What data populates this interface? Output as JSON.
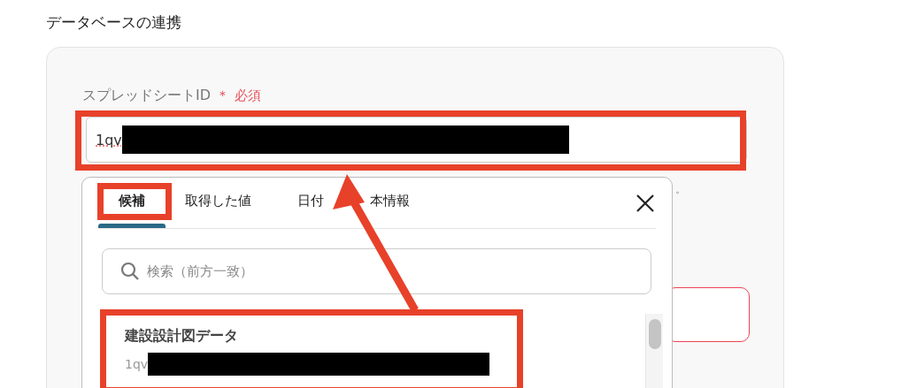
{
  "section_title": "データベースの連携",
  "field": {
    "label": "スプレッドシートID",
    "required_mark": "＊",
    "required_text": "必須",
    "value": "1qv"
  },
  "hint_fragment": "。",
  "popup": {
    "tabs": [
      {
        "label": "候補",
        "selected": true
      },
      {
        "label": "取得した値",
        "selected": false
      },
      {
        "label": "日付",
        "selected": false
      },
      {
        "label": "本情報",
        "selected": false
      }
    ],
    "search": {
      "placeholder": "検索（前方一致）"
    },
    "items": [
      {
        "title": "建設設計図データ",
        "subtitle": "1qv"
      }
    ]
  }
}
